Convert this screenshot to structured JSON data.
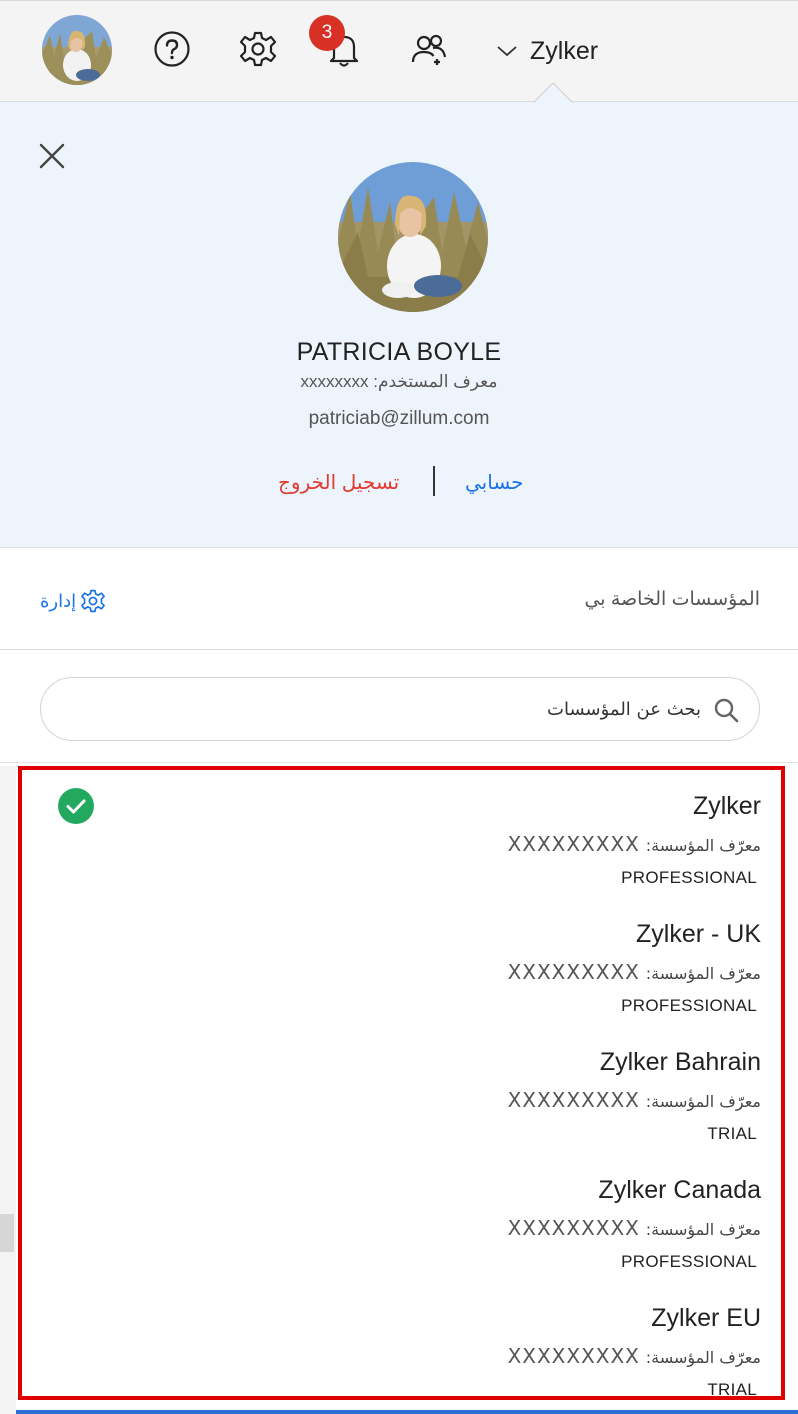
{
  "topbar": {
    "notification_count": "3",
    "org_switcher_label": "Zylker"
  },
  "profile": {
    "name": "PATRICIA BOYLE",
    "user_id_label": "معرف المستخدم:",
    "user_id_value": "xxxxxxxx",
    "email": "patriciab@zillum.com",
    "my_account_label": "حسابي",
    "sign_out_label": "تسجيل الخروج"
  },
  "orgs": {
    "title": "المؤسسات الخاصة بي",
    "manage_label": "إدارة",
    "search_placeholder": "بحث عن المؤسسات",
    "id_label": "معرّف المؤسسة:",
    "items": [
      {
        "name": "Zylker",
        "id": "XXXXXXXXX",
        "plan": "PROFESSIONAL",
        "selected": true
      },
      {
        "name": "Zylker - UK",
        "id": "XXXXXXXXX",
        "plan": "PROFESSIONAL",
        "selected": false
      },
      {
        "name": "Zylker Bahrain",
        "id": "XXXXXXXXX",
        "plan": "TRIAL",
        "selected": false
      },
      {
        "name": "Zylker Canada",
        "id": "XXXXXXXXX",
        "plan": "PROFESSIONAL",
        "selected": false
      },
      {
        "name": "Zylker EU",
        "id": "XXXXXXXXX",
        "plan": "TRIAL",
        "selected": false
      }
    ]
  },
  "colors": {
    "accent_blue": "#1a73e8",
    "signout_red": "#e03c31",
    "highlight_border": "#e00000",
    "selected_check": "#22a95f",
    "panel_bg": "#eef4fc"
  }
}
